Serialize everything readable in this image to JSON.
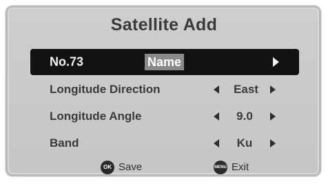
{
  "title": "Satellite Add",
  "selected_row": {
    "label": "No.73",
    "name_value": "Name"
  },
  "rows": [
    {
      "label": "Longitude Direction",
      "value": "East"
    },
    {
      "label": "Longitude Angle",
      "value": "9.0"
    },
    {
      "label": "Band",
      "value": "Ku"
    }
  ],
  "footer": {
    "save": {
      "icon": "OK",
      "label": "Save"
    },
    "exit": {
      "icon": "MENU",
      "label": "Exit"
    }
  },
  "colors": {
    "panel_bg": "#c9c9c9",
    "selected_bg": "#111111",
    "name_highlight": "#8a8a8a",
    "text": "#3a3a3a"
  }
}
